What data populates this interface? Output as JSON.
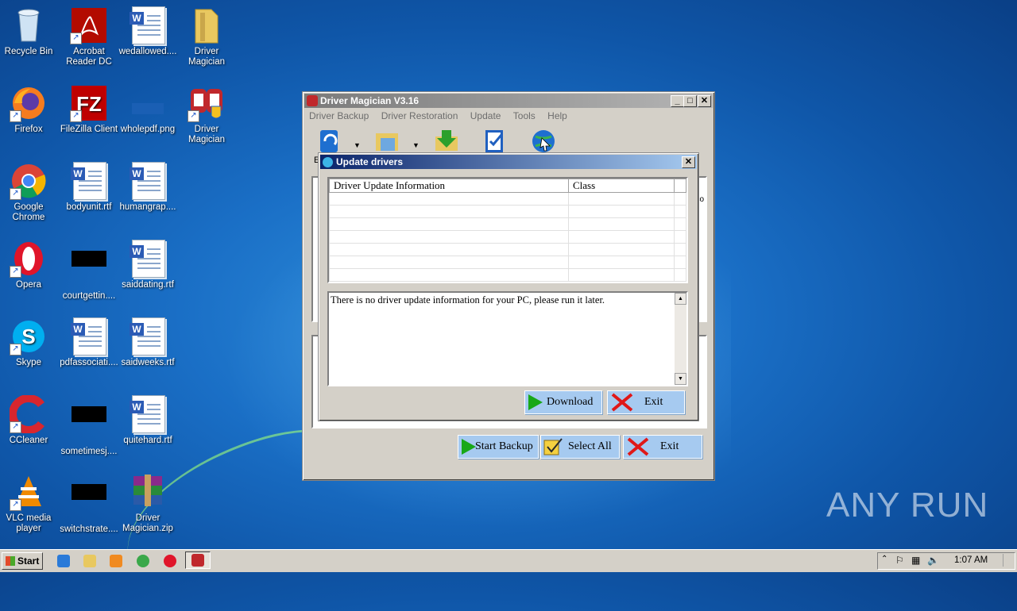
{
  "desktop": {
    "icons": [
      {
        "label": "Recycle Bin"
      },
      {
        "label": "Acrobat Reader DC"
      },
      {
        "label": "wedallowed...."
      },
      {
        "label": "Driver Magician"
      },
      {
        "label": "Firefox"
      },
      {
        "label": "FileZilla Client"
      },
      {
        "label": "wholepdf.png"
      },
      {
        "label": "Driver Magician"
      },
      {
        "label": "Google Chrome"
      },
      {
        "label": "bodyunit.rtf"
      },
      {
        "label": "humangrap...."
      },
      {
        "label": "Opera"
      },
      {
        "label": "courtgettin...."
      },
      {
        "label": "saiddating.rtf"
      },
      {
        "label": "Skype"
      },
      {
        "label": "pdfassociati...."
      },
      {
        "label": "saidweeks.rtf"
      },
      {
        "label": "CCleaner"
      },
      {
        "label": "sometimesj...."
      },
      {
        "label": "quitehard.rtf"
      },
      {
        "label": "VLC media player"
      },
      {
        "label": "switchstrate...."
      },
      {
        "label": "Driver Magician.zip"
      }
    ],
    "watermark": "ANY RUN"
  },
  "main_window": {
    "title": "Driver Magician V3.16",
    "menu": [
      "Driver Backup",
      "Driver Restoration",
      "Update",
      "Tools",
      "Help"
    ],
    "buttons": {
      "start_backup": "Start Backup",
      "select_all": "Select All",
      "exit": "Exit"
    },
    "partial_label": "E",
    "partial_text_right": "co"
  },
  "dialog": {
    "title": "Update drivers",
    "columns": [
      "Driver Update Information",
      "Class"
    ],
    "info_text": "There is no driver update information for your PC, please run it later.",
    "buttons": {
      "download": "Download",
      "exit": "Exit"
    }
  },
  "taskbar": {
    "start_label": "Start",
    "clock": "1:07 AM"
  }
}
